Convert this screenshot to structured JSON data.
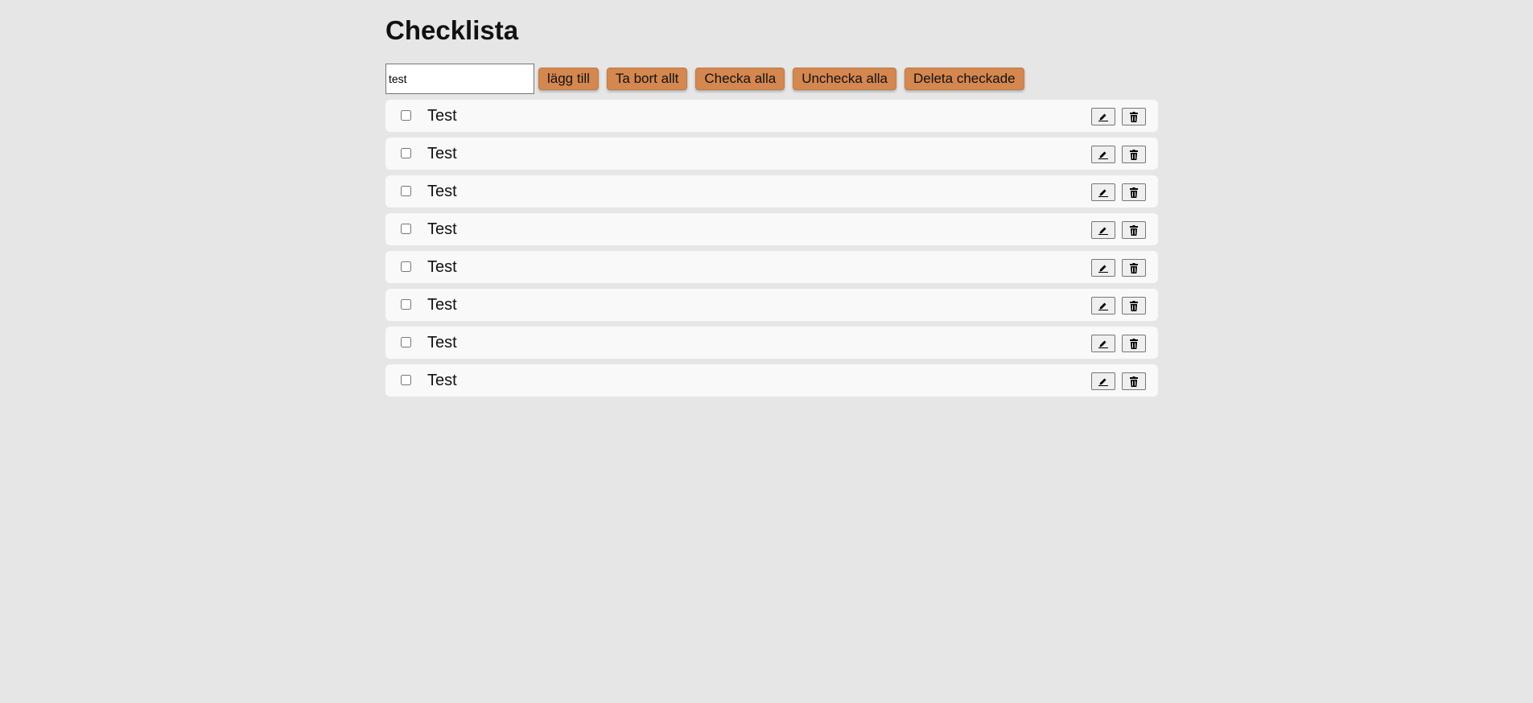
{
  "page": {
    "title": "Checklista"
  },
  "controls": {
    "input_value": "test",
    "add_label": "lägg till",
    "remove_all_label": "Ta bort allt",
    "check_all_label": "Checka alla",
    "uncheck_all_label": "Unchecka alla",
    "delete_checked_label": "Deleta checkade"
  },
  "items": [
    {
      "label": "Test",
      "checked": false,
      "edit_icon": "pencil-icon",
      "delete_icon": "trash-icon"
    },
    {
      "label": "Test",
      "checked": false,
      "edit_icon": "pencil-icon",
      "delete_icon": "trash-icon"
    },
    {
      "label": "Test",
      "checked": false,
      "edit_icon": "pencil-icon",
      "delete_icon": "trash-icon"
    },
    {
      "label": "Test",
      "checked": false,
      "edit_icon": "pencil-icon",
      "delete_icon": "trash-icon"
    },
    {
      "label": "Test",
      "checked": false,
      "edit_icon": "pencil-icon",
      "delete_icon": "trash-icon"
    },
    {
      "label": "Test",
      "checked": false,
      "edit_icon": "pencil-icon",
      "delete_icon": "trash-icon"
    },
    {
      "label": "Test",
      "checked": false,
      "edit_icon": "pencil-icon",
      "delete_icon": "trash-icon"
    },
    {
      "label": "Test",
      "checked": false,
      "edit_icon": "pencil-icon",
      "delete_icon": "trash-icon"
    }
  ],
  "colors": {
    "background": "#e6e6e6",
    "button": "#d4874e",
    "row": "#f9f9f9"
  }
}
